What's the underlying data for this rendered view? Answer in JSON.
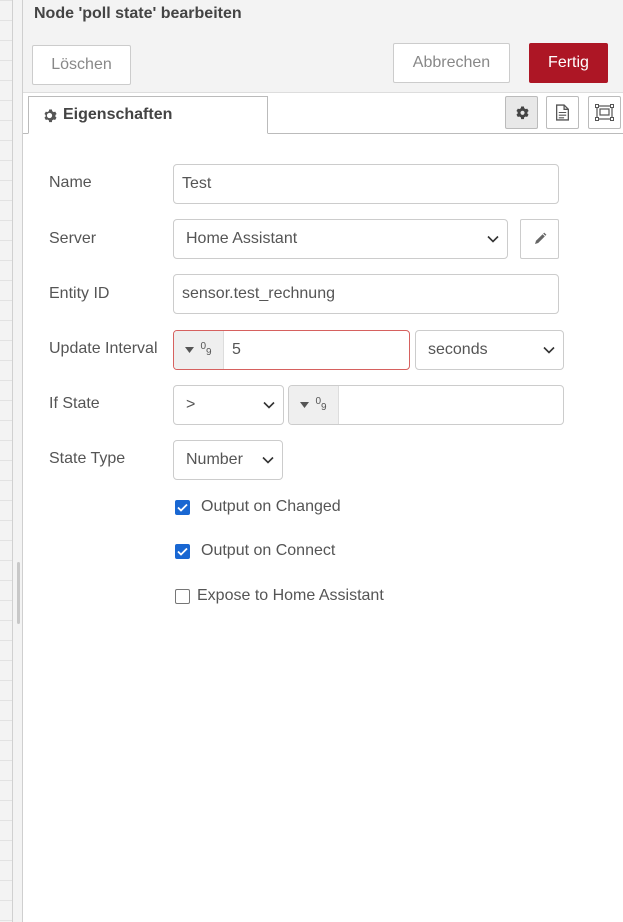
{
  "header": {
    "title": "Node 'poll state' bearbeiten",
    "delete_label": "Löschen",
    "cancel_label": "Abbrechen",
    "done_label": "Fertig"
  },
  "tabs": {
    "active_label": "Eigenschaften",
    "icons": [
      "gear-icon",
      "description-icon",
      "appearance-icon"
    ]
  },
  "form": {
    "name": {
      "label": "Name",
      "value": "Test"
    },
    "server": {
      "label": "Server",
      "value": "Home Assistant"
    },
    "entity_id": {
      "label": "Entity ID",
      "value": "sensor.test_rechnung"
    },
    "update_interval": {
      "label": "Update Interval",
      "value": "5",
      "unit": "seconds"
    },
    "if_state": {
      "label": "If State",
      "operator": ">",
      "value": ""
    },
    "state_type": {
      "label": "State Type",
      "value": "Number"
    },
    "number_type_glyph": "0",
    "number_type_glyph_sub": "9",
    "checkboxes": [
      {
        "label": "Output on Changed",
        "checked": true
      },
      {
        "label": "Output on Connect",
        "checked": true
      },
      {
        "label": "Expose to Home Assistant",
        "checked": false
      }
    ]
  },
  "colors": {
    "primary": "#ad1625",
    "checkbox": "#1967d2",
    "invalid_border": "#d6615f"
  }
}
